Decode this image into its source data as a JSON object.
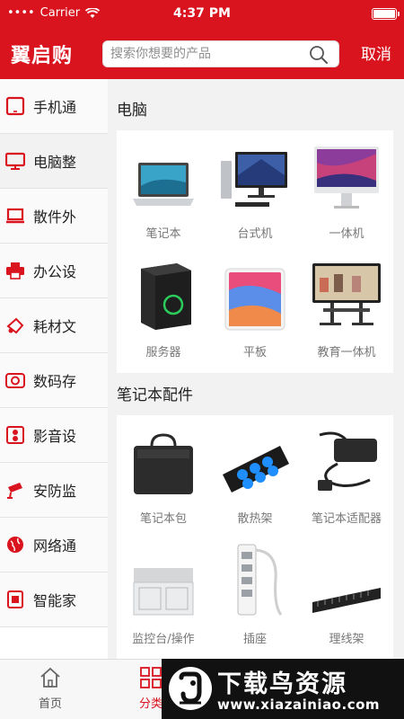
{
  "status_bar": {
    "carrier": "Carrier",
    "time": "4:37 PM"
  },
  "header": {
    "logo": "翼启购",
    "search_placeholder": "搜索你想要的产品",
    "cancel_label": "取消"
  },
  "sidebar": {
    "items": [
      {
        "label": "手机通",
        "icon": "phone-icon"
      },
      {
        "label": "电脑整",
        "icon": "monitor-icon",
        "active": true
      },
      {
        "label": "散件外",
        "icon": "laptop-icon"
      },
      {
        "label": "办公设",
        "icon": "printer-icon"
      },
      {
        "label": "耗材文",
        "icon": "ink-icon"
      },
      {
        "label": "数码存",
        "icon": "camera-icon"
      },
      {
        "label": "影音设",
        "icon": "speaker-icon"
      },
      {
        "label": "安防监",
        "icon": "cctv-icon"
      },
      {
        "label": "网络通",
        "icon": "globe-icon"
      },
      {
        "label": "智能家",
        "icon": "smart-home-icon"
      }
    ]
  },
  "content": {
    "sections": [
      {
        "title": "电脑",
        "products": [
          "笔记本",
          "台式机",
          "一体机",
          "服务器",
          "平板",
          "教育一体机"
        ]
      },
      {
        "title": "笔记本配件",
        "products": [
          "笔记本包",
          "散热架",
          "笔记本适配器",
          "监控台/操作",
          "插座",
          "理线架"
        ]
      }
    ]
  },
  "tabbar": {
    "tabs": [
      {
        "label": "首页",
        "icon": "home-icon"
      },
      {
        "label": "分类",
        "icon": "category-icon",
        "active": true
      }
    ]
  },
  "watermark": {
    "title": "下载鸟资源",
    "url": "www.xiazainiao.com"
  },
  "colors": {
    "brand": "#d9141e",
    "background": "#f2f2f2"
  }
}
